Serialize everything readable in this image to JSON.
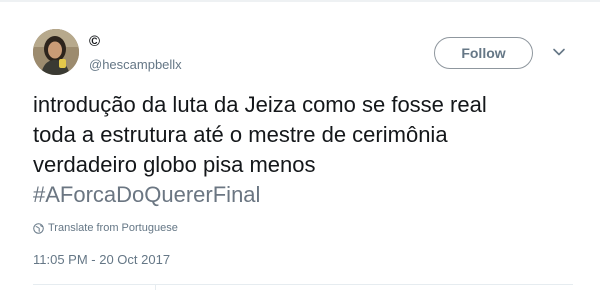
{
  "author": {
    "display_name": "©",
    "handle": "@hescampbellx"
  },
  "actions": {
    "follow_label": "Follow",
    "more_icon": "chevron-down-icon"
  },
  "tweet": {
    "lines": [
      "introdução da luta da Jeiza como se fosse real",
      "toda a estrutura até o mestre de cerimônia",
      "verdadeiro globo pisa menos"
    ],
    "hashtag": "#AForcaDoQuererFinal",
    "translate_label": "Translate from Portuguese",
    "translate_icon": "globe-icon",
    "timestamp": "11:05 PM - 20 Oct 2017"
  },
  "colors": {
    "text": "#14171a",
    "secondary": "#657786",
    "hashtag": "#6b7682",
    "button_border": "#8f979e"
  }
}
